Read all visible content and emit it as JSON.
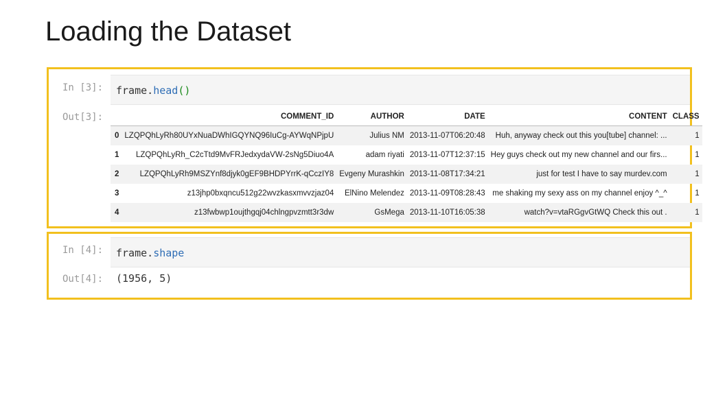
{
  "slide": {
    "title": "Loading the Dataset"
  },
  "cells": [
    {
      "in_prompt": "In [3]:",
      "code": {
        "object": "frame.",
        "method": "head",
        "parens": "()"
      },
      "out_prompt": "Out[3]:",
      "table": {
        "columns": [
          "",
          "COMMENT_ID",
          "AUTHOR",
          "DATE",
          "CONTENT",
          "CLASS"
        ],
        "rows": [
          [
            "0",
            "LZQPQhLyRh80UYxNuaDWhIGQYNQ96IuCg-AYWqNPjpU",
            "Julius NM",
            "2013-11-07T06:20:48",
            "Huh, anyway check out this you[tube] channel: ...",
            "1"
          ],
          [
            "1",
            "LZQPQhLyRh_C2cTtd9MvFRJedxydaVW-2sNg5Diuo4A",
            "adam riyati",
            "2013-11-07T12:37:15",
            "Hey guys check out my new channel and our firs...",
            "1"
          ],
          [
            "2",
            "LZQPQhLyRh9MSZYnf8djyk0gEF9BHDPYrrK-qCczIY8",
            "Evgeny Murashkin",
            "2013-11-08T17:34:21",
            "just for test I have to say murdev.com",
            "1"
          ],
          [
            "3",
            "z13jhp0bxqncu512g22wvzkasxmvvzjaz04",
            "ElNino Melendez",
            "2013-11-09T08:28:43",
            "me shaking my sexy ass on my channel enjoy ^_^",
            "1"
          ],
          [
            "4",
            "z13fwbwp1oujthgqj04chlngpvzmtt3r3dw",
            "GsMega",
            "2013-11-10T16:05:38",
            "watch?v=vtaRGgvGtWQ Check this out .",
            "1"
          ]
        ]
      }
    },
    {
      "in_prompt": "In [4]:",
      "code": {
        "object": "frame.",
        "method": "shape"
      },
      "out_prompt": "Out[4]:",
      "output": "(1956, 5)"
    }
  ],
  "colors": {
    "highlight_border": "#f2c01e",
    "code_method": "#2e6db5",
    "code_paren": "#1a8a1a"
  }
}
